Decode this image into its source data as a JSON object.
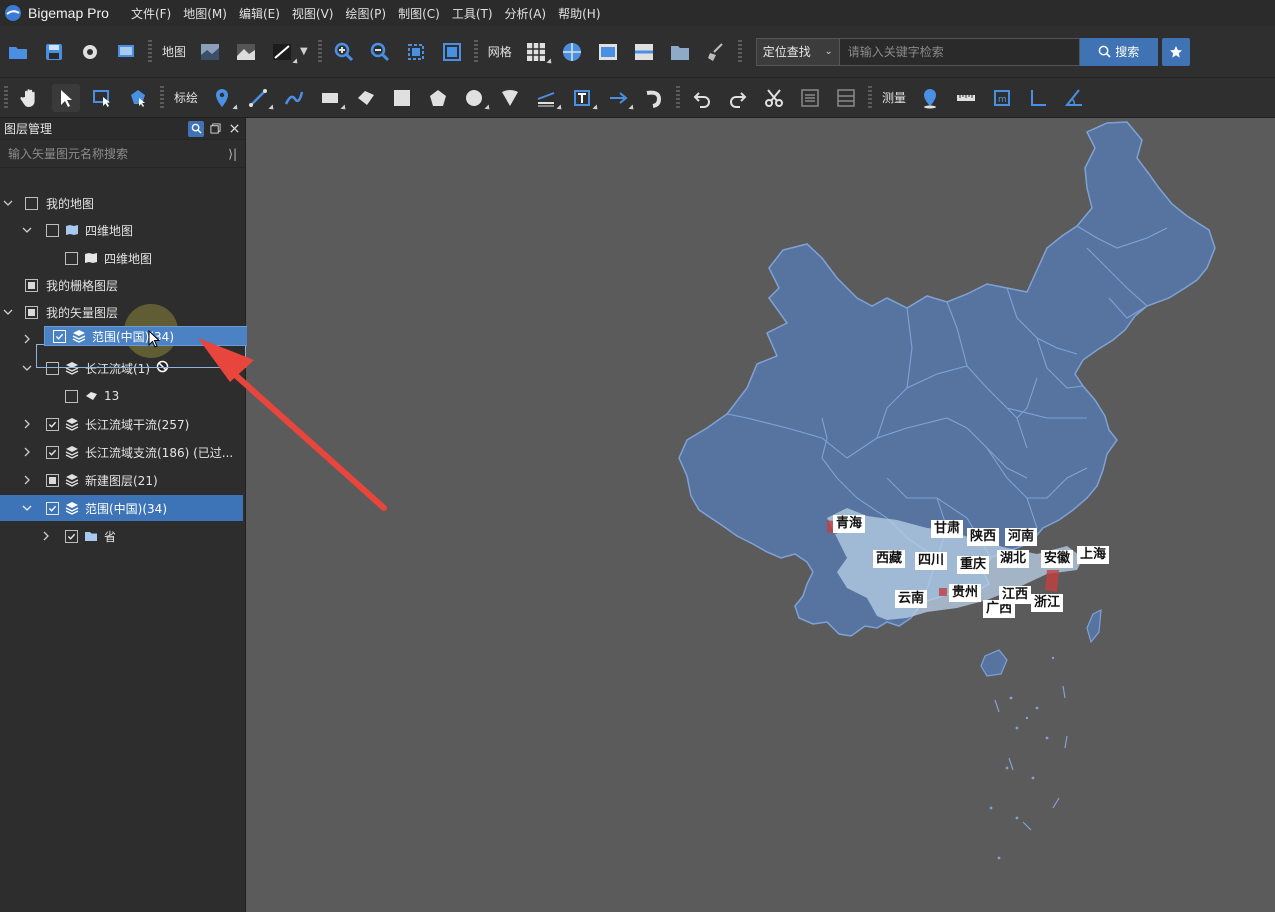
{
  "app": {
    "title": "Bigemap Pro"
  },
  "menu": [
    "文件(F)",
    "地图(M)",
    "编辑(E)",
    "视图(V)",
    "绘图(P)",
    "制图(C)",
    "工具(T)",
    "分析(A)",
    "帮助(H)"
  ],
  "toolbar1": {
    "map_label": "地图",
    "grid_label": "网格",
    "locate_select": "定位查找",
    "search_placeholder": "请输入关键字检索",
    "search_button": "搜索"
  },
  "toolbar2": {
    "draw_label": "标绘",
    "measure_label": "测量"
  },
  "panel": {
    "title": "图层管理",
    "search_placeholder": "输入矢量图元名称搜索"
  },
  "tree": {
    "my_map": "我的地图",
    "folder_3d": "四维地图",
    "item_3d": "四维地图",
    "raster": "我的栅格图层",
    "vector": "我的矢量图层",
    "changjiang": "长江流域(1)",
    "item_13": "13",
    "main_stream": "长江流域干流(257)",
    "branch_stream": "长江流域支流(186) (已过...",
    "new_layer": "新建图层(21)",
    "range_china": "范围(中国)(34)",
    "province": "省"
  },
  "drag": {
    "ghost_label": "范围(中国)(34)"
  },
  "map_labels": {
    "qinghai": "青海",
    "gansu": "甘肃",
    "shaanxi": "陕西",
    "henan": "河南",
    "xizang": "西藏",
    "sichuan": "四川",
    "chongqing": "重庆",
    "hubei": "湖北",
    "anhui": "安徽",
    "shanghai": "上海",
    "yunnan": "云南",
    "guizhou": "贵州",
    "guangxi": "广西",
    "jiangxi": "江西",
    "zhejiang": "浙江"
  },
  "colors": {
    "accent": "#3d74b8",
    "map_fill": "#56749f",
    "map_stroke": "#7fa2d6",
    "arrow": "#e8453c"
  }
}
